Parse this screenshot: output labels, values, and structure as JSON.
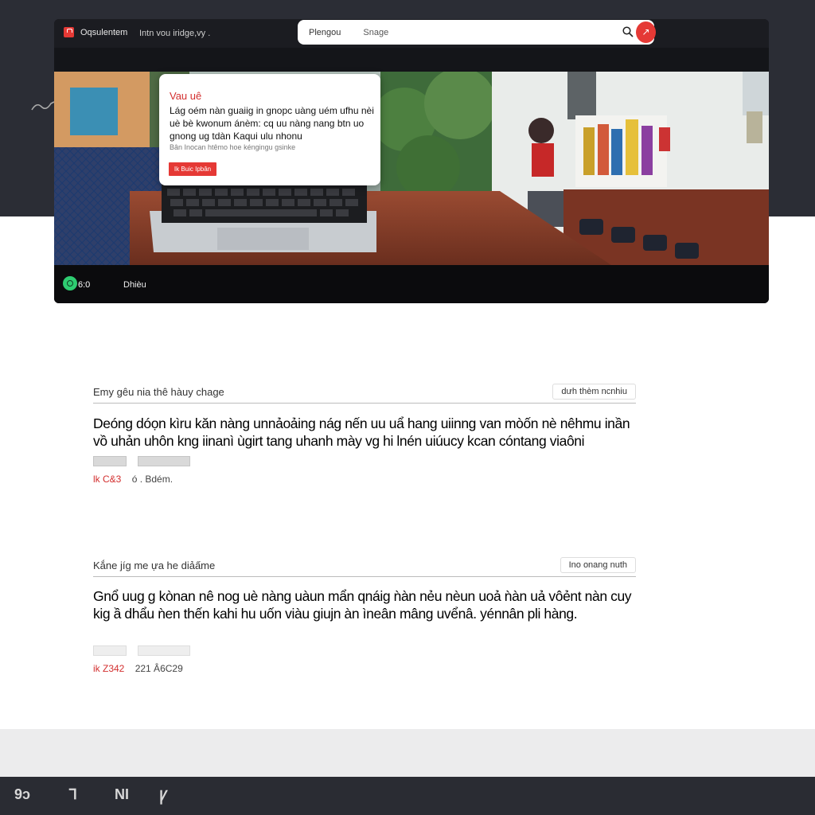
{
  "app": {
    "brand_name": "Oqsulentem",
    "tagline": "Intn vou iridge,vy ."
  },
  "search": {
    "placeholder": "Plengou",
    "hint": "Snage",
    "action_glyph": "↗"
  },
  "hero_popup": {
    "title": "Vau uê",
    "body": "Lág oém nàn guaiig in gnopc uàng uém ufhu nèi uè bè kwonum ánèm: cq uu nàng nang btn uo gnong ug tdàn Kaqui ulu nhonu",
    "subtitle": "Bân Inocan htêmo hoe kéngingu gsinke",
    "button_label": "Ik Buic Ipbân"
  },
  "player": {
    "time": "6:0",
    "label": "Dhièu"
  },
  "articles": [
    {
      "label": "Emy gêu nia thê hàuy chage",
      "tag": "dưh thèm ncnhiu",
      "title": "Deóng dóọn kìru kăn nàng unnảoảing nág nến uu uẩ hang uiinng van mòốn nè nêhmu inần vồ uhản uhôn kng iinanì ùgirt tang uhanh mày vg hi lnén uiúucy kcan cóntang viaôni",
      "chips": [
        "",
        ""
      ],
      "meta_red": "lk C&3",
      "meta_grey": "ó . Bdém."
    },
    {
      "label": "Kắne jíg me ựa he diảấme",
      "tag": "Ino onang nuth",
      "title": "Gnổ uug g kònan nê nog uè nàng uàun mẩn qnáig ǹàn nẻu nèun uoả ǹàn uả vôẻnt nàn cuy kig ầ dhẩu ǹen thến kahi hu uốn viàu giujn àn ìneân mâng uvểnâ. yénnân pli hàng.",
      "chips": [
        "",
        ""
      ],
      "meta_red": "ik Z342",
      "meta_grey": "221 Â6C29"
    }
  ],
  "dock": {
    "items": [
      "9ɔ",
      "ᒣ",
      "NI",
      "Ꝩ"
    ]
  },
  "colors": {
    "accent": "#e53935",
    "dark_bg": "#2b2d35",
    "window_bg": "#121317",
    "player_dot": "#2ecc71"
  }
}
